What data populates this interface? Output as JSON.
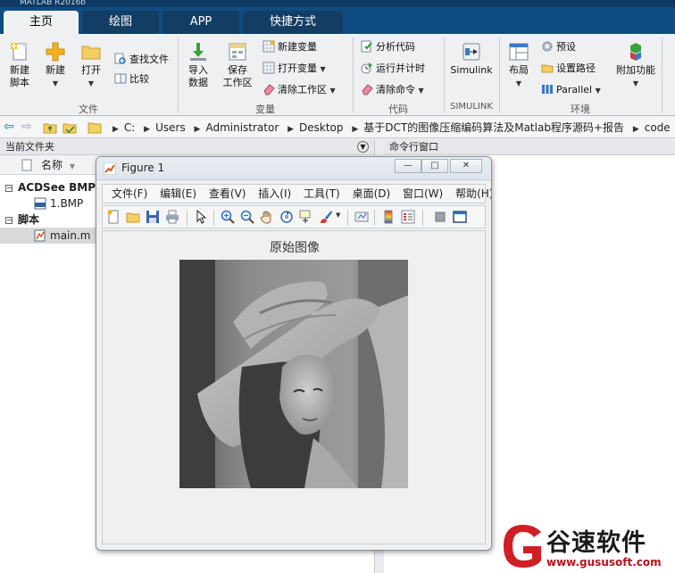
{
  "app": {
    "title_strip": "MATLAB R2016b"
  },
  "tabs": [
    {
      "label": "主页",
      "active": true
    },
    {
      "label": "绘图",
      "active": false
    },
    {
      "label": "APP",
      "active": false
    },
    {
      "label": "快捷方式",
      "active": false
    }
  ],
  "ribbon": {
    "file": {
      "new_script": "新建\n脚本",
      "new_script_l1": "新建",
      "new_script_l2": "脚本",
      "new": "新建",
      "open": "打开",
      "find_files": "查找文件",
      "compare": "比较",
      "group": "文件"
    },
    "variable": {
      "import_l1": "导入",
      "import_l2": "数据",
      "save_l1": "保存",
      "save_l2": "工作区",
      "new_variable": "新建变量",
      "open_variable": "打开变量",
      "clear_workspace": "清除工作区",
      "group": "变量"
    },
    "code": {
      "analyze": "分析代码",
      "run_time": "运行并计时",
      "clear_commands": "清除命令",
      "group": "代码"
    },
    "simulink": {
      "label": "Simulink",
      "group": "SIMULINK"
    },
    "environment": {
      "layout": "布局",
      "preferences": "预设",
      "set_path": "设置路径",
      "parallel": "Parallel",
      "addons": "附加功能",
      "group": "环境"
    }
  },
  "address": {
    "crumbs": [
      "C:",
      "Users",
      "Administrator",
      "Desktop",
      "基于DCT的图像压缩编码算法及Matlab程序源码+报告",
      "code"
    ]
  },
  "current_folder": {
    "title": "当前文件夹",
    "column_name": "名称",
    "groups": [
      {
        "label": "ACDSee BMP 图",
        "items": [
          "1.BMP"
        ]
      },
      {
        "label": "脚本",
        "items": [
          "main.m"
        ]
      }
    ],
    "selected": "main.m"
  },
  "command_window": {
    "title": "命令行窗口"
  },
  "figure": {
    "title": "Figure 1",
    "menu": [
      "文件(F)",
      "编辑(E)",
      "查看(V)",
      "插入(I)",
      "工具(T)",
      "桌面(D)",
      "窗口(W)",
      "帮助(H)"
    ],
    "menu_overflow": "»",
    "caption": "原始图像",
    "window_buttons": {
      "minimize": "—",
      "maximize": "□",
      "close": "✕"
    }
  },
  "watermark": {
    "text": "谷速软件",
    "url": "www.gususoft.com"
  },
  "colors": {
    "tab_bar": "#0f4c82",
    "accent": "#2d6fb5",
    "watermark_red": "#d11e25"
  }
}
